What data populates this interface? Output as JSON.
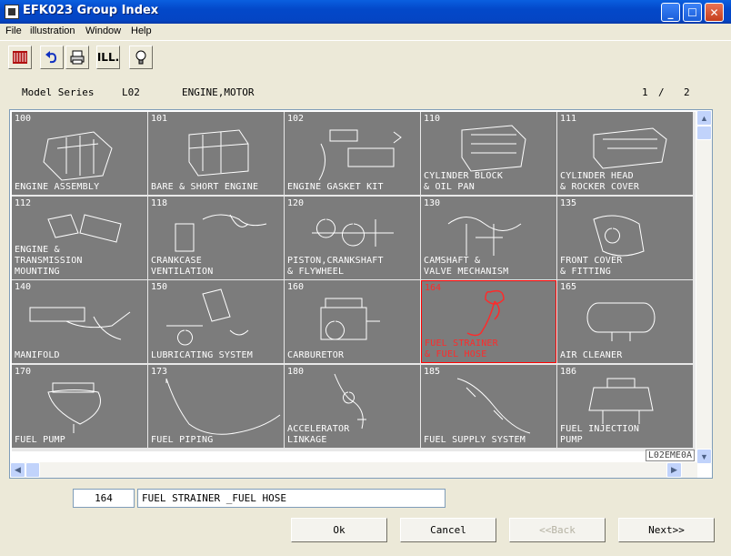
{
  "window": {
    "title": "EFK023 Group Index"
  },
  "menu": [
    "File",
    "illustration",
    "Window",
    "Help"
  ],
  "toolbar": {
    "tools": [
      {
        "name": "parts-book-icon"
      },
      {
        "name": "undo-icon"
      },
      {
        "name": "print-icon"
      },
      {
        "name": "illustration-icon",
        "glyph": "ILL."
      },
      {
        "name": "help-bulb-icon"
      }
    ]
  },
  "header": {
    "model_label": "Model Series",
    "model_value": "L02",
    "group_label": "ENGINE,MOTOR",
    "page_current": "1",
    "page_sep": "/",
    "page_total": "2"
  },
  "groups": [
    {
      "code": "100",
      "name": "ENGINE ASSEMBLY"
    },
    {
      "code": "101",
      "name": "BARE & SHORT ENGINE"
    },
    {
      "code": "102",
      "name": "ENGINE GASKET KIT"
    },
    {
      "code": "110",
      "name": "CYLINDER BLOCK\n& OIL PAN"
    },
    {
      "code": "111",
      "name": "CYLINDER HEAD\n& ROCKER COVER"
    },
    {
      "code": "112",
      "name": "ENGINE &\nTRANSMISSION\nMOUNTING"
    },
    {
      "code": "118",
      "name": "CRANKCASE\nVENTILATION"
    },
    {
      "code": "120",
      "name": "PISTON,CRANKSHAFT\n& FLYWHEEL"
    },
    {
      "code": "130",
      "name": "CAMSHAFT &\nVALVE MECHANISM"
    },
    {
      "code": "135",
      "name": "FRONT COVER\n& FITTING"
    },
    {
      "code": "140",
      "name": "MANIFOLD"
    },
    {
      "code": "150",
      "name": "LUBRICATING SYSTEM"
    },
    {
      "code": "160",
      "name": "CARBURETOR"
    },
    {
      "code": "164",
      "name": "FUEL STRAINER\n& FUEL HOSE",
      "selected": true
    },
    {
      "code": "165",
      "name": "AIR CLEANER"
    },
    {
      "code": "170",
      "name": "FUEL PUMP"
    },
    {
      "code": "173",
      "name": "FUEL PIPING"
    },
    {
      "code": "180",
      "name": "ACCELERATOR\nLINKAGE"
    },
    {
      "code": "185",
      "name": "FUEL SUPPLY SYSTEM"
    },
    {
      "code": "186",
      "name": "FUEL INJECTION\nPUMP"
    }
  ],
  "corner_label": "L02EME0A",
  "selection": {
    "code": "164",
    "name": "FUEL STRAINER _FUEL HOSE"
  },
  "buttons": {
    "ok": "Ok",
    "cancel": "Cancel",
    "back": "<<Back",
    "next": "Next>>"
  },
  "colors": {
    "cell_bg": "#7c7c7c",
    "selected": "#ff2a2a",
    "titlebar": "#0348c9"
  }
}
